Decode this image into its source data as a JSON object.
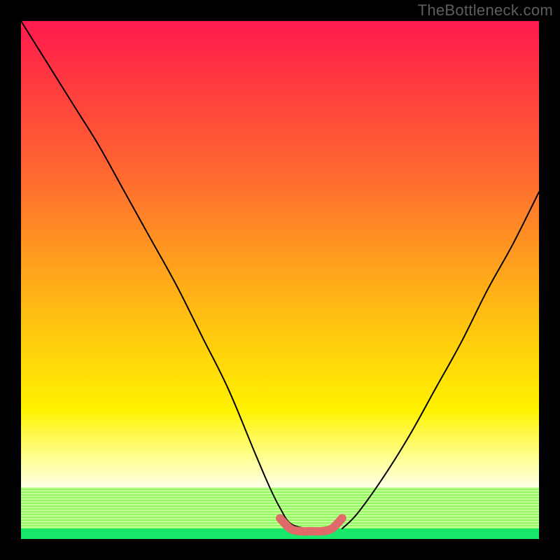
{
  "watermark": "TheBottleneck.com",
  "colors": {
    "curve_stroke": "#000000",
    "highlight_stroke": "#e06a6a"
  },
  "chart_data": {
    "type": "line",
    "title": "",
    "xlabel": "",
    "ylabel": "",
    "xlim": [
      0,
      100
    ],
    "ylim": [
      0,
      100
    ],
    "series": [
      {
        "name": "left-curve",
        "x": [
          0,
          5,
          10,
          15,
          20,
          25,
          30,
          35,
          40,
          45,
          48,
          50,
          52,
          55
        ],
        "y": [
          100,
          92,
          84,
          76,
          67,
          58,
          49,
          39,
          29,
          17,
          10,
          6,
          3,
          2
        ]
      },
      {
        "name": "right-curve",
        "x": [
          62,
          65,
          70,
          75,
          80,
          85,
          90,
          95,
          100
        ],
        "y": [
          2,
          5,
          12,
          20,
          29,
          38,
          48,
          57,
          67
        ]
      },
      {
        "name": "valley-highlight",
        "x": [
          50,
          52,
          54,
          56,
          58,
          60,
          62
        ],
        "y": [
          4,
          2,
          1.5,
          1.5,
          1.5,
          2,
          4
        ]
      }
    ]
  }
}
